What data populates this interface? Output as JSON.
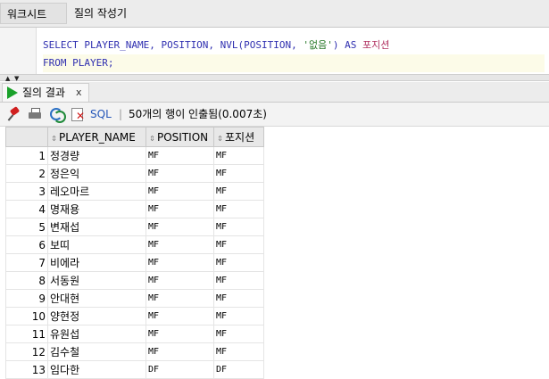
{
  "tabs": {
    "worksheet": "워크시트",
    "query_builder": "질의 작성기"
  },
  "editor": {
    "line1": [
      "SELECT PLAYER_NAME, POSITION, NVL(POSITION, ",
      "'없음'",
      ") AS ",
      "포지션"
    ],
    "line2": [
      "FROM PLAYER;"
    ]
  },
  "result_tab": {
    "label": "질의 결과",
    "close": "x"
  },
  "toolbar": {
    "sql_label": "SQL",
    "separator": "|",
    "status": "50개의 행이 인출됨(0.007초)"
  },
  "icons": {
    "pin": "pin-icon",
    "print": "printer-icon",
    "refresh": "refresh-icon",
    "cancel": "cancel-icon",
    "run": "run-icon"
  },
  "colors": {
    "keyword": "#3030b0",
    "string": "#2a7a2a",
    "run_green": "#1aa12a"
  },
  "grid": {
    "columns": [
      "PLAYER_NAME",
      "POSITION",
      "포지션"
    ],
    "rows": [
      [
        "1",
        "정경량",
        "MF",
        "MF"
      ],
      [
        "2",
        "정은익",
        "MF",
        "MF"
      ],
      [
        "3",
        "레오마르",
        "MF",
        "MF"
      ],
      [
        "4",
        "명재용",
        "MF",
        "MF"
      ],
      [
        "5",
        "변재섭",
        "MF",
        "MF"
      ],
      [
        "6",
        "보띠",
        "MF",
        "MF"
      ],
      [
        "7",
        "비에라",
        "MF",
        "MF"
      ],
      [
        "8",
        "서동원",
        "MF",
        "MF"
      ],
      [
        "9",
        "안대현",
        "MF",
        "MF"
      ],
      [
        "10",
        "양현정",
        "MF",
        "MF"
      ],
      [
        "11",
        "유원섭",
        "MF",
        "MF"
      ],
      [
        "12",
        "김수철",
        "MF",
        "MF"
      ],
      [
        "13",
        "임다한",
        "DF",
        "DF"
      ]
    ]
  }
}
